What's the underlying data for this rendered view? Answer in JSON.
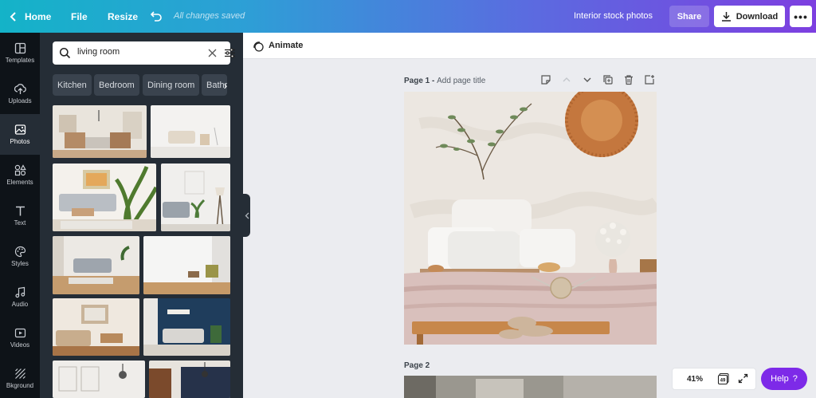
{
  "topbar": {
    "home_label": "Home",
    "file_label": "File",
    "resize_label": "Resize",
    "saved_status": "All changes saved",
    "design_title": "Interior stock photos",
    "share_label": "Share",
    "download_label": "Download",
    "more_label": "•••"
  },
  "rail": {
    "items": [
      {
        "label": "Templates",
        "icon": "templates-icon"
      },
      {
        "label": "Uploads",
        "icon": "upload-icon"
      },
      {
        "label": "Photos",
        "icon": "photos-icon",
        "active": true
      },
      {
        "label": "Elements",
        "icon": "elements-icon"
      },
      {
        "label": "Text",
        "icon": "text-icon"
      },
      {
        "label": "Styles",
        "icon": "styles-icon"
      },
      {
        "label": "Audio",
        "icon": "audio-icon"
      },
      {
        "label": "Videos",
        "icon": "videos-icon"
      },
      {
        "label": "Bkground",
        "icon": "background-icon"
      }
    ]
  },
  "panel": {
    "search_value": "living room",
    "chips": [
      "Kitchen",
      "Bedroom",
      "Dining room",
      "Bathroom"
    ]
  },
  "canvas": {
    "animate_label": "Animate",
    "page1_prefix": "Page 1 - ",
    "page1_title_placeholder": "Add page title",
    "page2_label": "Page 2"
  },
  "footer": {
    "zoom": "41%",
    "page_count": "49",
    "help_label": "Help",
    "help_icon": "?"
  },
  "colors": {
    "accent": "#7d2ae8",
    "rail_bg": "#0e1318",
    "panel_bg": "#252d36"
  }
}
